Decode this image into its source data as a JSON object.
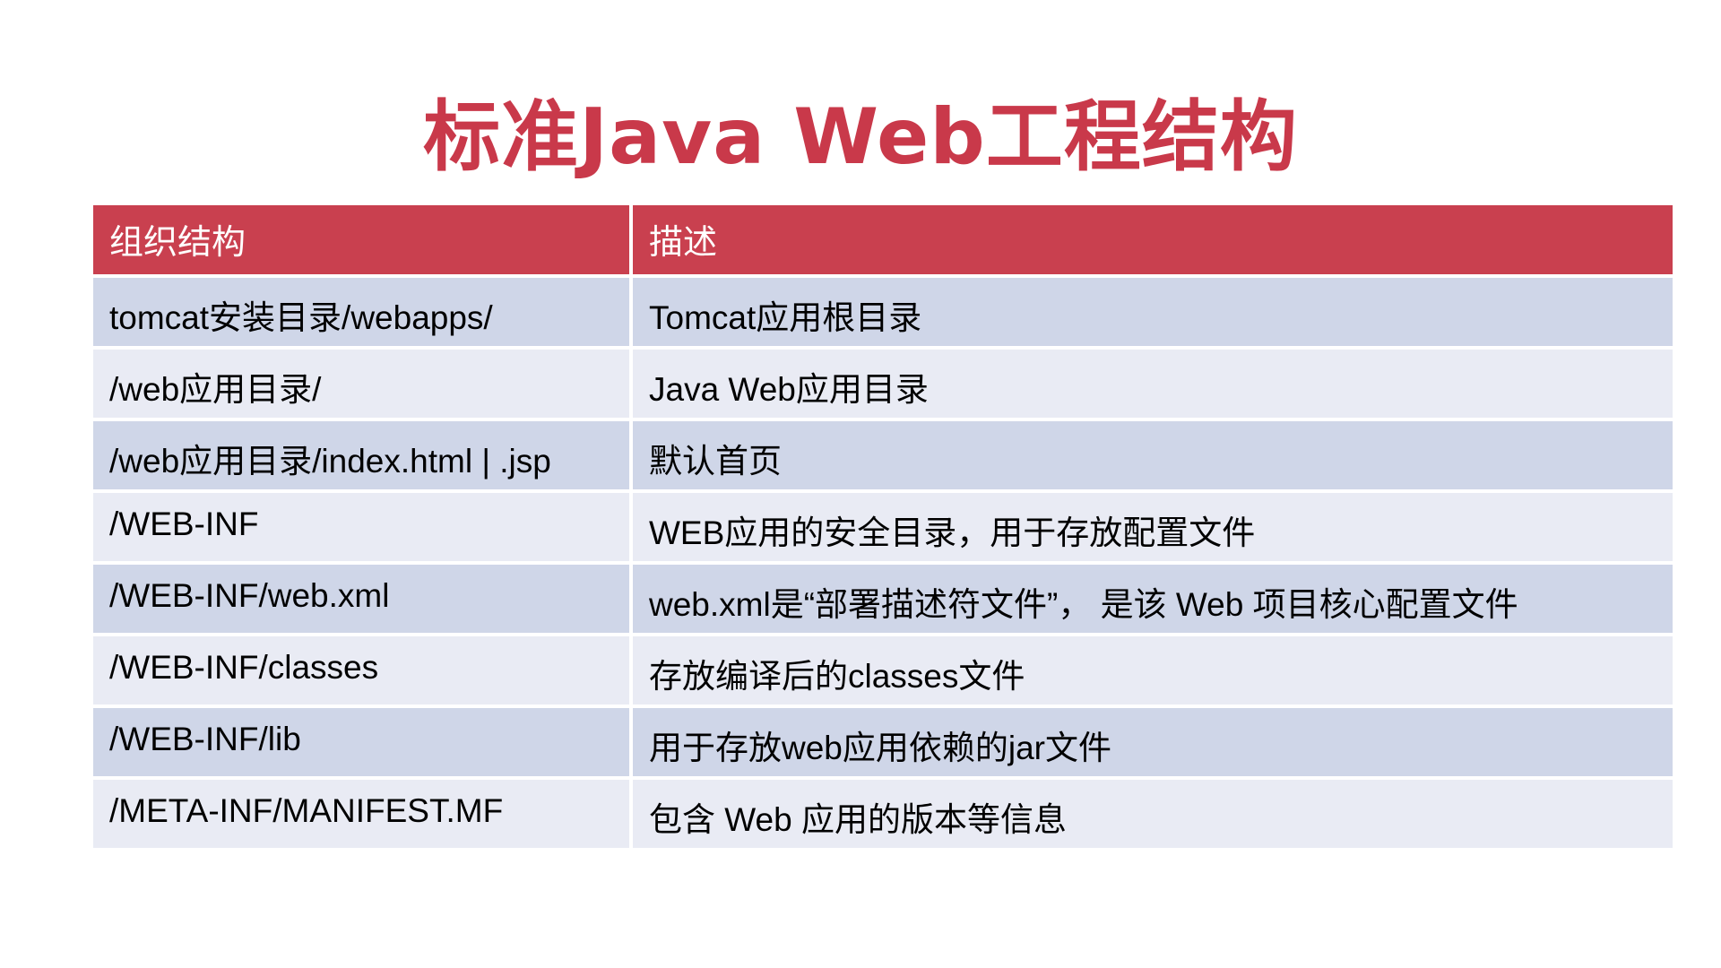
{
  "title": "标准Java Web工程结构",
  "table": {
    "headers": [
      "组织结构",
      "描述"
    ],
    "rows": [
      [
        "tomcat安装目录/webapps/",
        "Tomcat应用根目录"
      ],
      [
        "/web应用目录/",
        "Java Web应用目录"
      ],
      [
        "/web应用目录/index.html | .jsp",
        "默认首页"
      ],
      [
        "/WEB-INF",
        "WEB应用的安全目录，用于存放配置文件"
      ],
      [
        "/WEB-INF/web.xml",
        "web.xml是“部署描述符文件”， 是该 Web 项目核心配置文件"
      ],
      [
        "/WEB-INF/classes",
        "存放编译后的classes文件"
      ],
      [
        "/WEB-INF/lib",
        "用于存放web应用依赖的jar文件"
      ],
      [
        "/META-INF/MANIFEST.MF",
        "包含 Web 应用的版本等信息"
      ]
    ]
  },
  "colors": {
    "title": "#c9394a",
    "header_bg": "#c9404f",
    "row_dark": "#cfd6e8",
    "row_light": "#e9ebf4"
  }
}
